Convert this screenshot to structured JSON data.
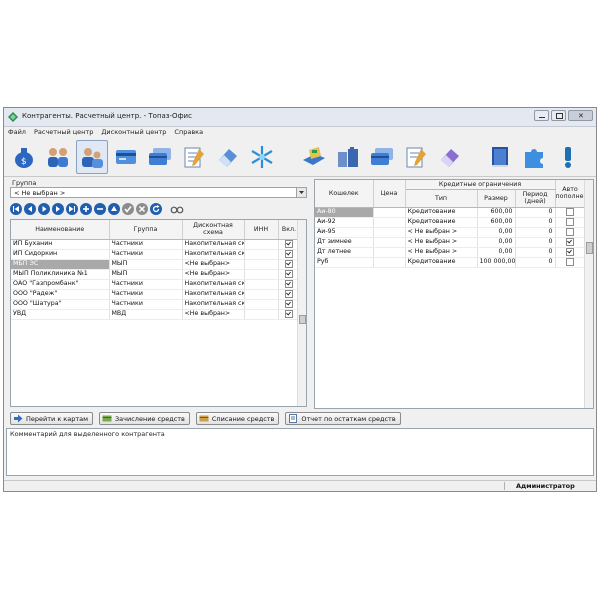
{
  "window": {
    "title": "Контрагенты. Расчетный центр. - Топаз-Офис"
  },
  "menu": [
    "Файл",
    "Расчетный центр",
    "Дисконтный центр",
    "Справка"
  ],
  "toolbar_icons": [
    "money-bag-icon",
    "users-icon",
    "contractors-icon",
    "card-icon",
    "cards-icon",
    "notepad-icon",
    "eraser-icon",
    "snowflake-icon",
    "payment-terminal-icon",
    "fuel-cans-icon",
    "cards-blue-icon",
    "notepad-pencil-icon",
    "eraser-purple-icon",
    "book-icon",
    "puzzle-icon",
    "info-icon"
  ],
  "left": {
    "group_label": "Группа",
    "group_value": "< Не выбран >",
    "nav_buttons": [
      "first-icon",
      "prev-icon",
      "play-icon",
      "next-icon",
      "last-icon",
      "add-icon",
      "remove-icon",
      "up-icon",
      "check-icon",
      "cancel-icon",
      "refresh-icon",
      "glasses-icon"
    ],
    "columns": [
      "Наименование",
      "Группа",
      "Дисконтная схема",
      "ИНН",
      "Вкл."
    ],
    "rows": [
      {
        "name": "ИП Буханин",
        "group": "Частники",
        "scheme": "Накопительная ски",
        "inn": "",
        "on": true
      },
      {
        "name": "ИП Сидоркин",
        "group": "Частники",
        "scheme": "Накопительная ски",
        "inn": "",
        "on": true
      },
      {
        "name": "МБП ЭС",
        "group": "МЫП",
        "scheme": "<Не выбран>",
        "inn": "",
        "on": true,
        "selected": true
      },
      {
        "name": "МЫП Поликлиника №1",
        "group": "МЫП",
        "scheme": "<Не выбран>",
        "inn": "",
        "on": true
      },
      {
        "name": "ОАО \"Газпромбанк\"",
        "group": "Частники",
        "scheme": "Накопительная ски",
        "inn": "",
        "on": true
      },
      {
        "name": "ООО \"Радеж\"",
        "group": "Частники",
        "scheme": "Накопительная ски",
        "inn": "",
        "on": true
      },
      {
        "name": "ООО \"Шатура\"",
        "group": "Частники",
        "scheme": "Накопительная ски",
        "inn": "",
        "on": true
      },
      {
        "name": "УВД",
        "group": "МВД",
        "scheme": "<Не выбран>",
        "inn": "",
        "on": true
      }
    ]
  },
  "right": {
    "col_wallet": "Кошелек",
    "col_price": "Цена",
    "credit_group": "Кредитные ограничения",
    "col_type": "Тип",
    "col_size": "Размер",
    "col_period": "Период (дней)",
    "col_auto": "Авто пополнение",
    "rows": [
      {
        "wallet": "Аи-80",
        "price": "",
        "type": "Кредитование",
        "size": "600,00",
        "period": "0",
        "auto": false,
        "selected": true
      },
      {
        "wallet": "Аи-92",
        "price": "",
        "type": "Кредитование",
        "size": "600,00",
        "period": "0",
        "auto": false
      },
      {
        "wallet": "Аи-95",
        "price": "",
        "type": "< Не выбран >",
        "size": "0,00",
        "period": "0",
        "auto": false
      },
      {
        "wallet": "Дт зимнее",
        "price": "",
        "type": "< Не выбран >",
        "size": "0,00",
        "period": "0",
        "auto": true
      },
      {
        "wallet": "Дт летнее",
        "price": "",
        "type": "< Не выбран >",
        "size": "0,00",
        "period": "0",
        "auto": true
      },
      {
        "wallet": "Руб",
        "price": "",
        "type": "Кредитование",
        "size": "100 000,00",
        "period": "0",
        "auto": false
      }
    ]
  },
  "buttons": {
    "goto_cards": "Перейти к картам",
    "credit": "Зачисление средств",
    "debit": "Списание средств",
    "report": "Отчет по остаткам средств"
  },
  "comment_label": "Комментарий для выделенного контрагента",
  "status": {
    "user": "Администратор"
  },
  "colors": {
    "accent": "#1f6fb5",
    "selection": "#a9a9a9",
    "titlebar": "#e4e9f1"
  }
}
